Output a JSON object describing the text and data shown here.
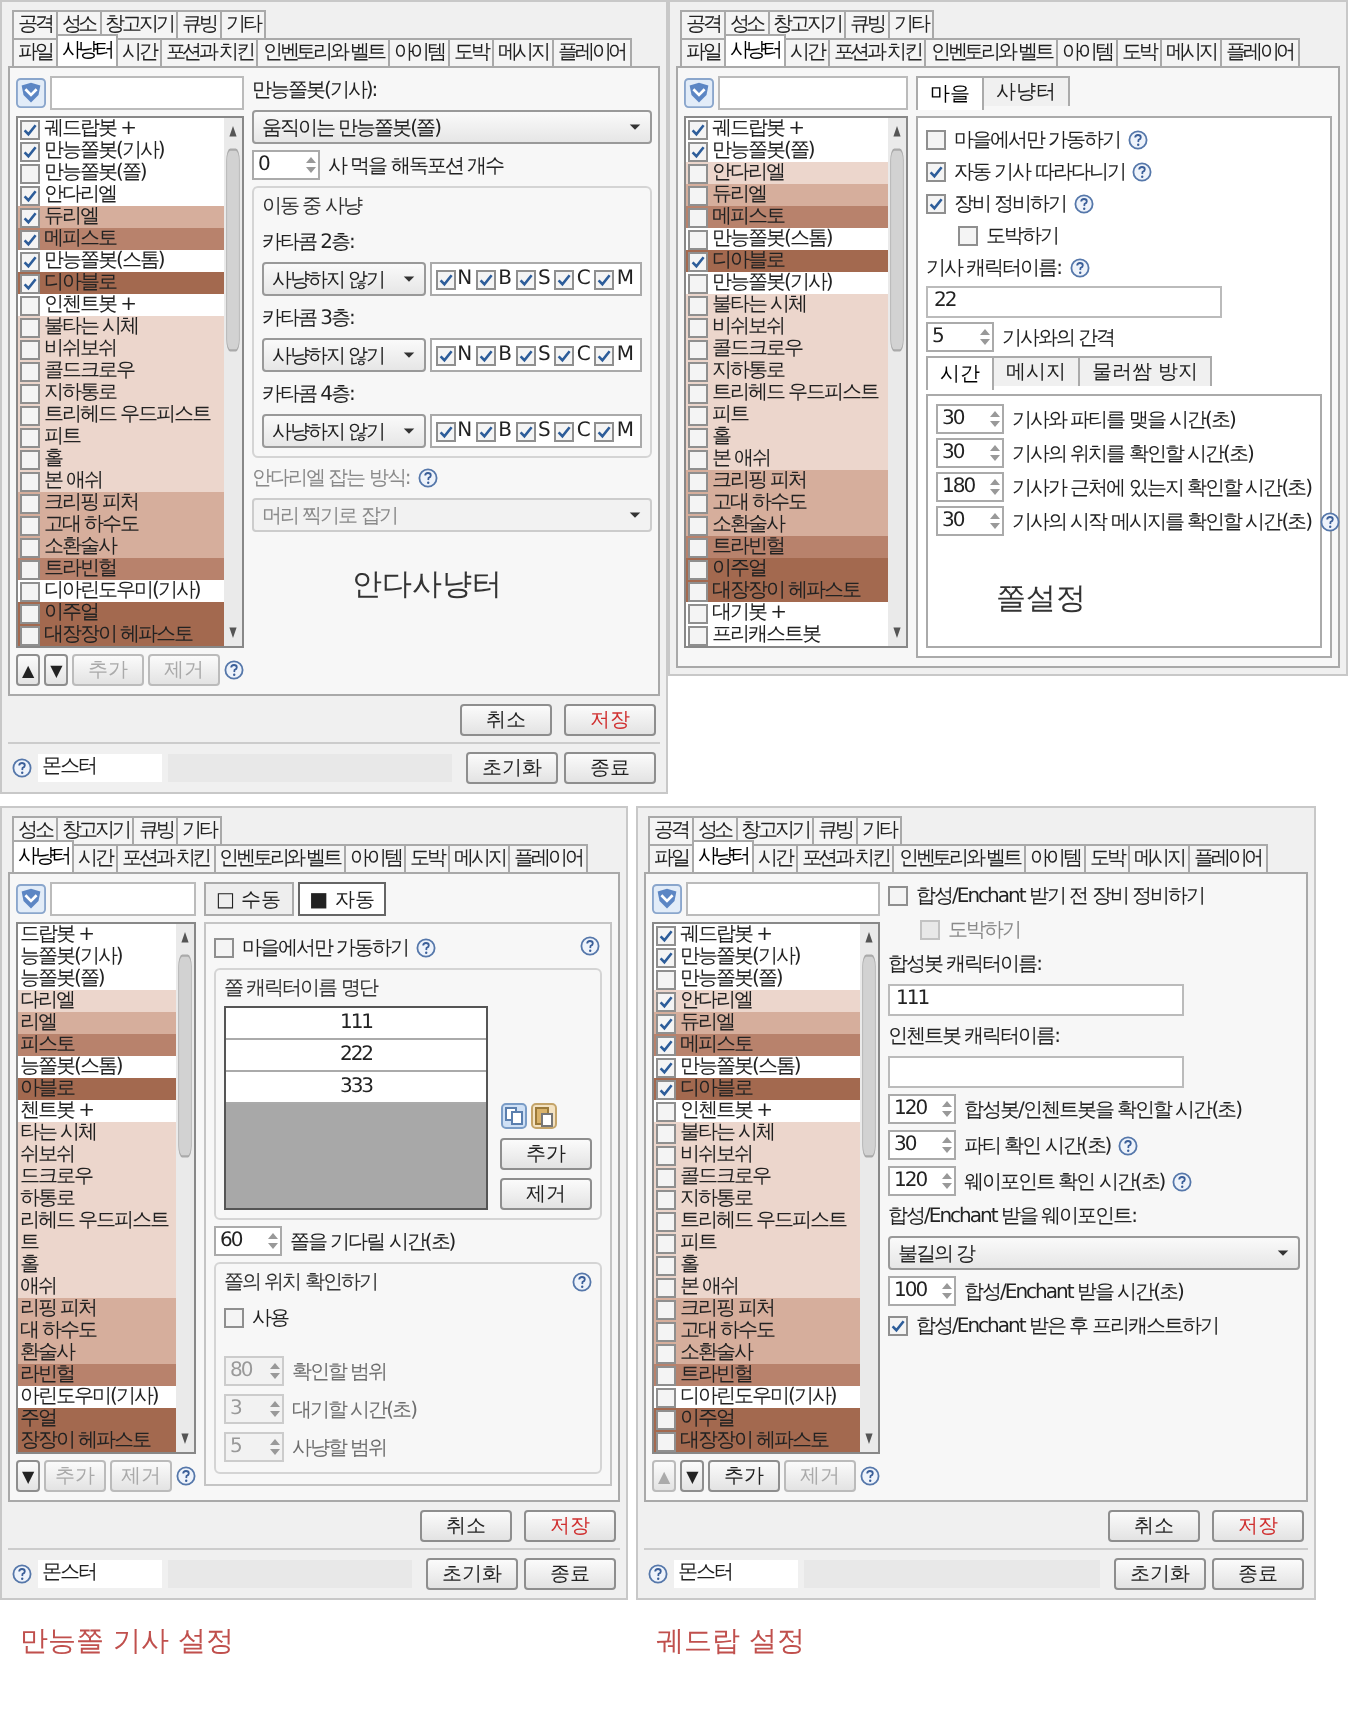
{
  "panels": [
    {
      "tabs_top": [
        {
          "label": "공격",
          "selected": false
        },
        {
          "label": "성소",
          "selected": false
        },
        {
          "label": "창고지기",
          "selected": false
        },
        {
          "label": "큐빙",
          "selected": false
        },
        {
          "label": "기타",
          "selected": false
        }
      ],
      "tabs_bottom": [
        {
          "label": "파일",
          "selected": false
        },
        {
          "label": "사냥터",
          "selected": true
        },
        {
          "label": "시간",
          "selected": false
        },
        {
          "label": "포션과 치킨",
          "selected": false
        },
        {
          "label": "인벤토리와 벨트",
          "selected": false
        },
        {
          "label": "아이템",
          "selected": false
        },
        {
          "label": "도박",
          "selected": false
        },
        {
          "label": "메시지",
          "selected": false
        },
        {
          "label": "플레이어",
          "selected": false
        }
      ],
      "monsters": [
        {
          "name": "궤드랍봇 +",
          "checked": true,
          "color": "#ffffff"
        },
        {
          "name": "만능쫄봇(기사)",
          "checked": true,
          "color": "#ffffff"
        },
        {
          "name": "만능쫄봇(쫄)",
          "checked": false,
          "color": "#ffffff"
        },
        {
          "name": "안다리엘",
          "checked": true,
          "color": "#ffffff"
        },
        {
          "name": "듀리엘",
          "checked": true,
          "color": "#d6ae9c"
        },
        {
          "name": "메피스토",
          "checked": true,
          "color": "#b8826c"
        },
        {
          "name": "만능쫄봇(스톰)",
          "checked": true,
          "color": "#ffffff"
        },
        {
          "name": "디아블로",
          "checked": true,
          "color": "#a3694f"
        },
        {
          "name": "인첸트봇 +",
          "checked": false,
          "color": "#ffffff"
        },
        {
          "name": "불타는 시체",
          "checked": false,
          "color": "#ecd6cc"
        },
        {
          "name": "비쉬보쉬",
          "checked": false,
          "color": "#ecd6cc"
        },
        {
          "name": "콜드크로우",
          "checked": false,
          "color": "#ecd6cc"
        },
        {
          "name": "지하통로",
          "checked": false,
          "color": "#ecd6cc"
        },
        {
          "name": "트리헤드 우드피스트",
          "checked": false,
          "color": "#ecd6cc"
        },
        {
          "name": "피트",
          "checked": false,
          "color": "#ecd6cc"
        },
        {
          "name": "홀",
          "checked": false,
          "color": "#ecd6cc"
        },
        {
          "name": "본 애쉬",
          "checked": false,
          "color": "#ecd6cc"
        },
        {
          "name": "크리핑 피처",
          "checked": false,
          "color": "#d6ae9c"
        },
        {
          "name": "고대 하수도",
          "checked": false,
          "color": "#d6ae9c"
        },
        {
          "name": "소환술사",
          "checked": false,
          "color": "#d6ae9c"
        },
        {
          "name": "트라빈헐",
          "checked": false,
          "color": "#b8826c"
        },
        {
          "name": "디아린도우미(기사)",
          "checked": false,
          "color": "#ffffff"
        },
        {
          "name": "이주얼",
          "checked": false,
          "color": "#a3694f"
        },
        {
          "name": "대장장이 헤파스토",
          "checked": false,
          "color": "#a3694f"
        }
      ],
      "list_buttons": [
        {
          "label": "▲",
          "disabled": false
        },
        {
          "label": "▼",
          "disabled": false
        },
        {
          "label": "추가",
          "disabled": true
        },
        {
          "label": "제거",
          "disabled": true
        }
      ],
      "content": [
        {
          "kind": "label",
          "text": "만능쫄봇(기사):"
        },
        {
          "kind": "dropdown",
          "value": "움직이는 만능쫄봇(쫄)"
        },
        {
          "kind": "spin",
          "value": "0",
          "label": "사 먹을 해독포션 개수"
        },
        {
          "kind": "group",
          "title": "이동 중 사냥",
          "children": [
            {
              "kind": "label",
              "text": "카타콤 2층:"
            },
            {
              "kind": "floor_row",
              "value": "사냥하지 않기",
              "toggles": [
                {
                  "label": "N",
                  "checked": true
                },
                {
                  "label": "B",
                  "checked": true
                },
                {
                  "label": "S",
                  "checked": true
                },
                {
                  "label": "C",
                  "checked": true
                },
                {
                  "label": "M",
                  "checked": true
                }
              ]
            },
            {
              "kind": "label",
              "text": "카타콤 3층:"
            },
            {
              "kind": "floor_row",
              "value": "사냥하지 않기",
              "toggles": [
                {
                  "label": "N",
                  "checked": true
                },
                {
                  "label": "B",
                  "checked": true
                },
                {
                  "label": "S",
                  "checked": true
                },
                {
                  "label": "C",
                  "checked": true
                },
                {
                  "label": "M",
                  "checked": true
                }
              ]
            },
            {
              "kind": "label",
              "text": "카타콤 4층:"
            },
            {
              "kind": "floor_row",
              "value": "사냥하지 않기",
              "toggles": [
                {
                  "label": "N",
                  "checked": true
                },
                {
                  "label": "B",
                  "checked": true
                },
                {
                  "label": "S",
                  "checked": true
                },
                {
                  "label": "C",
                  "checked": true
                },
                {
                  "label": "M",
                  "checked": true
                }
              ]
            }
          ]
        },
        {
          "kind": "label",
          "text": "안다리엘 잡는 방식:",
          "help": true,
          "disabled": true
        },
        {
          "kind": "dropdown",
          "value": "머리 찍기로 잡기",
          "disabled": true
        },
        {
          "kind": "caption",
          "text": "안다사냥터"
        }
      ],
      "dialog_buttons": [
        {
          "label": "취소",
          "kind": "cancel"
        },
        {
          "label": "저장",
          "kind": "save"
        }
      ],
      "footer": {
        "field": "몬스터",
        "buttons": [
          "초기화",
          "종료"
        ]
      }
    },
    {
      "tabs_top": [
        {
          "label": "공격",
          "selected": false
        },
        {
          "label": "성소",
          "selected": false
        },
        {
          "label": "창고지기",
          "selected": false
        },
        {
          "label": "큐빙",
          "selected": false
        },
        {
          "label": "기타",
          "selected": false
        }
      ],
      "tabs_bottom": [
        {
          "label": "파일",
          "selected": false
        },
        {
          "label": "사냥터",
          "selected": true
        },
        {
          "label": "시간",
          "selected": false
        },
        {
          "label": "포션과 치킨",
          "selected": false
        },
        {
          "label": "인벤토리와 벨트",
          "selected": false
        },
        {
          "label": "아이템",
          "selected": false
        },
        {
          "label": "도박",
          "selected": false
        },
        {
          "label": "메시지",
          "selected": false
        },
        {
          "label": "플레이어",
          "selected": false
        }
      ],
      "monsters": [
        {
          "name": "궤드랍봇 +",
          "checked": true,
          "color": "#ffffff"
        },
        {
          "name": "만능쫄봇(쫄)",
          "checked": true,
          "color": "#ffffff"
        },
        {
          "name": "안다리엘",
          "checked": false,
          "color": "#ecd6cc"
        },
        {
          "name": "듀리엘",
          "checked": false,
          "color": "#d6ae9c"
        },
        {
          "name": "메피스토",
          "checked": false,
          "color": "#b8826c"
        },
        {
          "name": "만능쫄봇(스톰)",
          "checked": false,
          "color": "#ffffff"
        },
        {
          "name": "디아블로",
          "checked": true,
          "color": "#a3694f"
        },
        {
          "name": "만능쫄봇(기사)",
          "checked": false,
          "color": "#ffffff"
        },
        {
          "name": "불타는 시체",
          "checked": false,
          "color": "#ecd6cc"
        },
        {
          "name": "비쉬보쉬",
          "checked": false,
          "color": "#ecd6cc"
        },
        {
          "name": "콜드크로우",
          "checked": false,
          "color": "#ecd6cc"
        },
        {
          "name": "지하통로",
          "checked": false,
          "color": "#ecd6cc"
        },
        {
          "name": "트리헤드 우드피스트",
          "checked": false,
          "color": "#ecd6cc"
        },
        {
          "name": "피트",
          "checked": false,
          "color": "#ecd6cc"
        },
        {
          "name": "홀",
          "checked": false,
          "color": "#ecd6cc"
        },
        {
          "name": "본 애쉬",
          "checked": false,
          "color": "#ecd6cc"
        },
        {
          "name": "크리핑 피처",
          "checked": false,
          "color": "#d6ae9c"
        },
        {
          "name": "고대 하수도",
          "checked": false,
          "color": "#d6ae9c"
        },
        {
          "name": "소환술사",
          "checked": false,
          "color": "#d6ae9c"
        },
        {
          "name": "트라빈헐",
          "checked": false,
          "color": "#b8826c"
        },
        {
          "name": "이주얼",
          "checked": false,
          "color": "#a3694f"
        },
        {
          "name": "대장장이 헤파스토",
          "checked": false,
          "color": "#a3694f"
        },
        {
          "name": "대기봇 +",
          "checked": false,
          "color": "#ffffff"
        },
        {
          "name": "프리캐스트봇",
          "checked": false,
          "color": "#ffffff"
        }
      ],
      "content": [
        {
          "kind": "tabs",
          "tabs": [
            {
              "label": "마을",
              "selected": true
            },
            {
              "label": "사냥터",
              "selected": false
            }
          ],
          "children": [
            {
              "kind": "checkbox",
              "label": "마을에서만 가동하기",
              "checked": false,
              "help": true
            },
            {
              "kind": "checkbox",
              "label": "자동 기사 따라다니기",
              "checked": true,
              "help": true
            },
            {
              "kind": "checkbox",
              "label": "장비 정비하기",
              "checked": true,
              "help": true,
              "children": [
                {
                  "kind": "checkbox",
                  "label": "도박하기",
                  "checked": false
                }
              ]
            },
            {
              "kind": "label",
              "text": "기사 캐릭터이름:",
              "help": true
            },
            {
              "kind": "field",
              "value": "22"
            },
            {
              "kind": "spin",
              "value": "5",
              "label": "기사와의 간격"
            },
            {
              "kind": "tabs",
              "tabs": [
                {
                  "label": "시간",
                  "selected": true
                },
                {
                  "label": "메시지",
                  "selected": false
                },
                {
                  "label": "물러쌈 방지",
                  "selected": false
                }
              ],
              "children": [
                {
                  "kind": "spin",
                  "value": "30",
                  "label": "기사와 파티를 맺을 시간(초)"
                },
                {
                  "kind": "spin",
                  "value": "30",
                  "label": "기사의 위치를 확인할 시간(초)"
                },
                {
                  "kind": "spin",
                  "value": "180",
                  "label": "기사가 근처에 있는지 확인할 시간(초)"
                },
                {
                  "kind": "spin",
                  "value": "30",
                  "label": "기사의 시작 메시지를 확인할 시간(초)",
                  "help": true
                },
                {
                  "kind": "caption",
                  "text": "쫄설정"
                }
              ]
            }
          ]
        }
      ]
    },
    {
      "tabs_top": [
        {
          "label": "성소",
          "selected": false
        },
        {
          "label": "창고지기",
          "selected": false
        },
        {
          "label": "큐빙",
          "selected": false
        },
        {
          "label": "기타",
          "selected": false
        }
      ],
      "tabs_bottom": [
        {
          "label": "사냥터",
          "selected": true
        },
        {
          "label": "시간",
          "selected": false
        },
        {
          "label": "포션과 치킨",
          "selected": false
        },
        {
          "label": "인벤토리와 벨트",
          "selected": false
        },
        {
          "label": "아이템",
          "selected": false
        },
        {
          "label": "도박",
          "selected": false
        },
        {
          "label": "메시지",
          "selected": false
        },
        {
          "label": "플레이어",
          "selected": false
        }
      ],
      "monsters": [
        {
          "name": "드랍봇 +",
          "color": "#ffffff"
        },
        {
          "name": "능쫄봇(기사)",
          "color": "#ffffff"
        },
        {
          "name": "능쫄봇(쫄)",
          "color": "#ffffff"
        },
        {
          "name": "다리엘",
          "color": "#ecd6cc"
        },
        {
          "name": "리엘",
          "color": "#d6ae9c"
        },
        {
          "name": "피스토",
          "color": "#b8826c"
        },
        {
          "name": "능쫄봇(스톰)",
          "color": "#ffffff"
        },
        {
          "name": "아블로",
          "color": "#a3694f"
        },
        {
          "name": "첸트봇 +",
          "color": "#ffffff"
        },
        {
          "name": "타는 시체",
          "color": "#ecd6cc"
        },
        {
          "name": "쉬보쉬",
          "color": "#ecd6cc"
        },
        {
          "name": "드크로우",
          "color": "#ecd6cc"
        },
        {
          "name": "하통로",
          "color": "#ecd6cc"
        },
        {
          "name": "리헤드 우드피스트",
          "color": "#ecd6cc"
        },
        {
          "name": "트",
          "color": "#ecd6cc"
        },
        {
          "name": "홀",
          "color": "#ecd6cc"
        },
        {
          "name": "애쉬",
          "color": "#ecd6cc"
        },
        {
          "name": "리핑 피처",
          "color": "#d6ae9c"
        },
        {
          "name": "대 하수도",
          "color": "#d6ae9c"
        },
        {
          "name": "환술사",
          "color": "#d6ae9c"
        },
        {
          "name": "라빈헐",
          "color": "#b8826c"
        },
        {
          "name": "아린도우미(기사)",
          "color": "#ffffff"
        },
        {
          "name": "주얼",
          "color": "#a3694f"
        },
        {
          "name": "장장이 헤파스토",
          "color": "#a3694f"
        }
      ],
      "list_buttons": [
        {
          "label": "▼",
          "disabled": false
        },
        {
          "label": "추가",
          "disabled": true
        },
        {
          "label": "제거",
          "disabled": true
        }
      ],
      "content": [
        {
          "kind": "mode_toggle",
          "options": [
            {
              "label": "□ 수동",
              "selected": false
            },
            {
              "label": "■ 자동",
              "selected": true
            }
          ]
        },
        {
          "kind": "frame",
          "help": true,
          "children": [
            {
              "kind": "checkbox",
              "label": "마을에서만 가동하기",
              "checked": false,
              "help": true
            },
            {
              "kind": "group",
              "title": "쫄 캐릭터이름 명단",
              "children": [
                {
                  "kind": "name_list",
                  "rows": [
                    "111",
                    "222",
                    "333"
                  ],
                  "buttons": [
                    "추가",
                    "제거"
                  ]
                }
              ]
            },
            {
              "kind": "spin",
              "value": "60",
              "label": "쫄을 기다릴 시간(초)"
            },
            {
              "kind": "group",
              "title": "쫄의 위치 확인하기",
              "help": true,
              "children": [
                {
                  "kind": "checkbox",
                  "label": "사용",
                  "checked": false
                },
                {
                  "kind": "spin",
                  "value": "80",
                  "label": "확인할 범위",
                  "disabled": true
                },
                {
                  "kind": "spin",
                  "value": "3",
                  "label": "대기할 시간(초)",
                  "disabled": true
                },
                {
                  "kind": "spin",
                  "value": "5",
                  "label": "사냥할 범위",
                  "disabled": true
                }
              ]
            }
          ]
        }
      ],
      "dialog_buttons": [
        {
          "label": "취소",
          "kind": "cancel"
        },
        {
          "label": "저장",
          "kind": "save"
        }
      ],
      "footer": {
        "field": "몬스터",
        "buttons": [
          "초기화",
          "종료"
        ]
      },
      "caption": "만능쫄 기사 설정"
    },
    {
      "tabs_top": [
        {
          "label": "공격",
          "selected": false
        },
        {
          "label": "성소",
          "selected": false
        },
        {
          "label": "창고지기",
          "selected": false
        },
        {
          "label": "큐빙",
          "selected": false
        },
        {
          "label": "기타",
          "selected": false
        }
      ],
      "tabs_bottom": [
        {
          "label": "파일",
          "selected": false
        },
        {
          "label": "사냥터",
          "selected": true
        },
        {
          "label": "시간",
          "selected": false
        },
        {
          "label": "포션과 치킨",
          "selected": false
        },
        {
          "label": "인벤토리와 벨트",
          "selected": false
        },
        {
          "label": "아이템",
          "selected": false
        },
        {
          "label": "도박",
          "selected": false
        },
        {
          "label": "메시지",
          "selected": false
        },
        {
          "label": "플레이어",
          "selected": false
        }
      ],
      "monsters": [
        {
          "name": "궤드랍봇 +",
          "checked": true,
          "color": "#ffffff"
        },
        {
          "name": "만능쫄봇(기사)",
          "checked": true,
          "color": "#ffffff"
        },
        {
          "name": "만능쫄봇(쫄)",
          "checked": false,
          "color": "#ffffff"
        },
        {
          "name": "안다리엘",
          "checked": true,
          "color": "#ecd6cc"
        },
        {
          "name": "듀리엘",
          "checked": true,
          "color": "#d6ae9c"
        },
        {
          "name": "메피스토",
          "checked": true,
          "color": "#b8826c"
        },
        {
          "name": "만능쫄봇(스톰)",
          "checked": true,
          "color": "#ffffff"
        },
        {
          "name": "디아블로",
          "checked": true,
          "color": "#a3694f"
        },
        {
          "name": "인첸트봇 +",
          "checked": false,
          "color": "#ffffff"
        },
        {
          "name": "불타는 시체",
          "checked": false,
          "color": "#ecd6cc"
        },
        {
          "name": "비쉬보쉬",
          "checked": false,
          "color": "#ecd6cc"
        },
        {
          "name": "콜드크로우",
          "checked": false,
          "color": "#ecd6cc"
        },
        {
          "name": "지하통로",
          "checked": false,
          "color": "#ecd6cc"
        },
        {
          "name": "트리헤드 우드피스트",
          "checked": false,
          "color": "#ecd6cc"
        },
        {
          "name": "피트",
          "checked": false,
          "color": "#ecd6cc"
        },
        {
          "name": "홀",
          "checked": false,
          "color": "#ecd6cc"
        },
        {
          "name": "본 애쉬",
          "checked": false,
          "color": "#ecd6cc"
        },
        {
          "name": "크리핑 피처",
          "checked": false,
          "color": "#d6ae9c"
        },
        {
          "name": "고대 하수도",
          "checked": false,
          "color": "#d6ae9c"
        },
        {
          "name": "소환술사",
          "checked": false,
          "color": "#d6ae9c"
        },
        {
          "name": "트라빈헐",
          "checked": false,
          "color": "#b8826c"
        },
        {
          "name": "디아린도우미(기사)",
          "checked": false,
          "color": "#ffffff"
        },
        {
          "name": "이주얼",
          "checked": false,
          "color": "#a3694f"
        },
        {
          "name": "대장장이 헤파스토",
          "checked": false,
          "color": "#a3694f"
        }
      ],
      "list_buttons": [
        {
          "label": "▲",
          "disabled": true
        },
        {
          "label": "▼",
          "disabled": false
        },
        {
          "label": "추가",
          "disabled": false
        },
        {
          "label": "제거",
          "disabled": true
        }
      ],
      "content": [
        {
          "kind": "checkbox",
          "label": "합성/Enchant 받기 전 장비 정비하기",
          "checked": false,
          "children": [
            {
              "kind": "checkbox",
              "label": "도박하기",
              "checked": false,
              "disabled": true
            }
          ]
        },
        {
          "kind": "label",
          "text": "합성봇 캐릭터이름:"
        },
        {
          "kind": "field",
          "value": "111"
        },
        {
          "kind": "label",
          "text": "인첸트봇 캐릭터이름:"
        },
        {
          "kind": "field"
        },
        {
          "kind": "spin",
          "value": "120",
          "label": "합성봇/인첸트봇을 확인할 시간(초)"
        },
        {
          "kind": "spin",
          "value": "30",
          "label": "파티 확인 시간(초)",
          "help": true
        },
        {
          "kind": "spin",
          "value": "120",
          "label": "웨이포인트 확인 시간(초)",
          "help": true
        },
        {
          "kind": "label",
          "text": "합성/Enchant 받을 웨이포인트:"
        },
        {
          "kind": "dropdown",
          "value": "불길의 강"
        },
        {
          "kind": "spin",
          "value": "100",
          "label": "합성/Enchant 받을 시간(초)"
        },
        {
          "kind": "checkbox",
          "label": "합성/Enchant 받은 후 프리캐스트하기",
          "checked": true
        }
      ],
      "dialog_buttons": [
        {
          "label": "취소",
          "kind": "cancel"
        },
        {
          "label": "저장",
          "kind": "save"
        }
      ],
      "footer": {
        "field": "몬스터",
        "buttons": [
          "초기화",
          "종료"
        ]
      },
      "caption": "궤드랍 설정"
    }
  ]
}
